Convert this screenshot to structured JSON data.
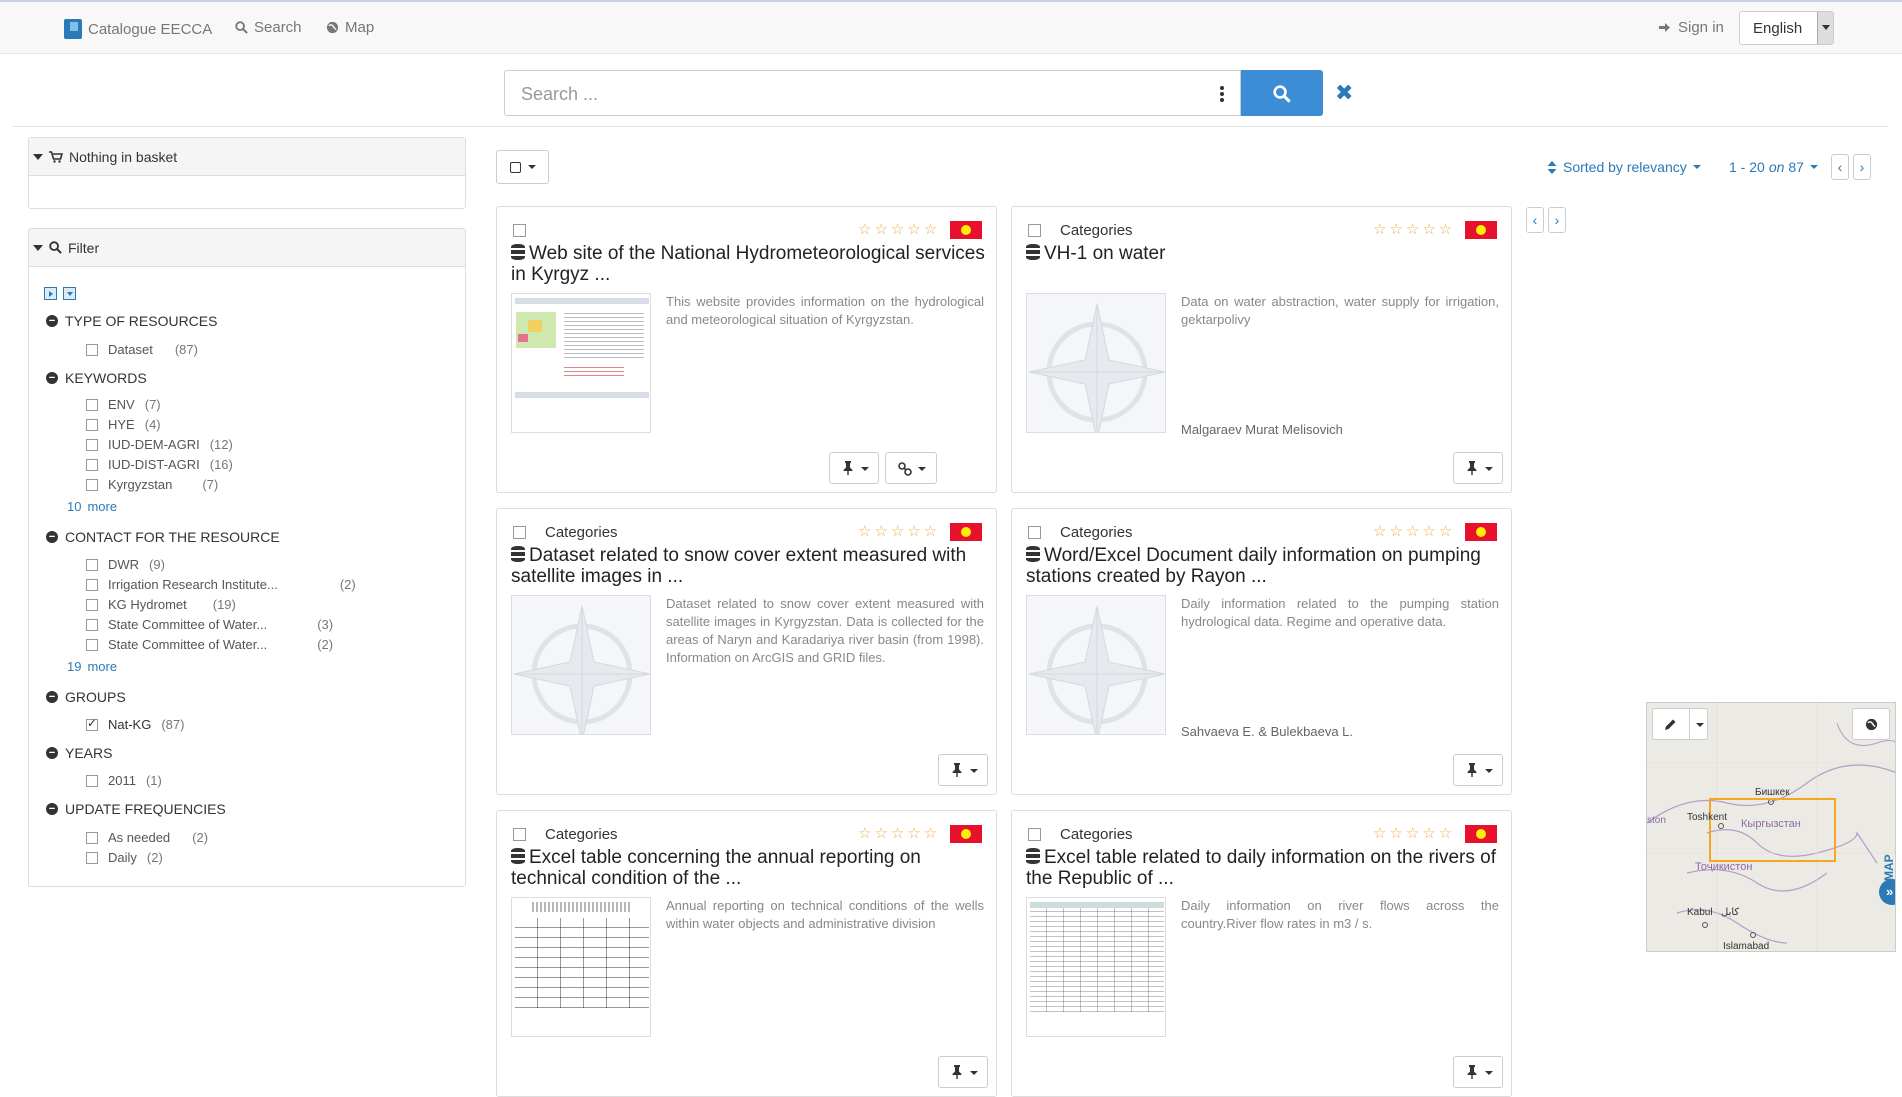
{
  "navbar": {
    "brand": "Catalogue EECCA",
    "search": "Search",
    "map": "Map",
    "signin": "Sign in",
    "language": "English"
  },
  "search": {
    "placeholder": "Search ..."
  },
  "basket": {
    "title": "Nothing in basket"
  },
  "filter": {
    "title": "Filter",
    "facets": [
      {
        "title": "TYPE OF RESOURCES",
        "items": [
          {
            "label": "Dataset",
            "count": "(87)"
          }
        ]
      },
      {
        "title": "KEYWORDS",
        "items": [
          {
            "label": "ENV",
            "count": "(7)"
          },
          {
            "label": "HYE",
            "count": "(4)"
          },
          {
            "label": "IUD-DEM-AGRI",
            "count": "(12)"
          },
          {
            "label": "IUD-DIST-AGRI",
            "count": "(16)"
          },
          {
            "label": "Kyrgyzstan",
            "count": "(7)"
          }
        ],
        "more_count": "10",
        "more_label": "more"
      },
      {
        "title": "CONTACT FOR THE RESOURCE",
        "items": [
          {
            "label": "DWR",
            "count": "(9)"
          },
          {
            "label": "Irrigation Research Institute...",
            "count": "(2)"
          },
          {
            "label": "KG Hydromet",
            "count": "(19)"
          },
          {
            "label": "State Committee of Water...",
            "count": "(3)"
          },
          {
            "label": "State Committee of Water...",
            "count": "(2)"
          }
        ],
        "more_count": "19",
        "more_label": "more"
      },
      {
        "title": "GROUPS",
        "items": [
          {
            "label": "Nat-KG",
            "count": "(87)",
            "checked": true
          }
        ]
      },
      {
        "title": "YEARS",
        "items": [
          {
            "label": "2011",
            "count": "(1)"
          }
        ]
      },
      {
        "title": "UPDATE FREQUENCIES",
        "items": [
          {
            "label": "As needed",
            "count": "(2)"
          },
          {
            "label": "Daily",
            "count": "(2)"
          }
        ]
      }
    ]
  },
  "results": {
    "sort_label": "Sorted by relevancy",
    "range_start": "1 - 20",
    "range_on": "on",
    "range_total": "87",
    "cards": [
      {
        "category": "",
        "title": "Web site of the National Hydrometeorological services in Kyrgyz ...",
        "description": "This website provides information on the hydrological and meteorological situation of Kyrgyzstan.",
        "author": "",
        "thumb": "website",
        "has_link_button": true
      },
      {
        "category": "Categories",
        "title": "VH-1 on water",
        "description": "Data on water abstraction, water supply for irrigation, gektarpolivy",
        "author": "Malgaraev Murat Melisovich",
        "thumb": "compass",
        "has_link_button": false
      },
      {
        "category": "Categories",
        "title": "Dataset related to snow cover extent measured with satellite images in ...",
        "description": "Dataset related to snow cover extent measured with satellite images in Kyrgyzstan. Data is collected for the areas of Naryn and Karadariya river basin (from 1998). Information on ArcGIS and GRID files.",
        "author": "",
        "thumb": "compass",
        "has_link_button": false
      },
      {
        "category": "Categories",
        "title": "Word/Excel Document daily information on pumping stations created by Rayon ...",
        "description": "Daily information related to the pumping station hydrological data. Regime and operative data.",
        "author": "Sahvaeva E. & Bulekbaeva L.",
        "thumb": "compass",
        "has_link_button": false
      },
      {
        "category": "Categories",
        "title": "Excel table concerning the annual reporting on technical condition of the ...",
        "description": "Annual reporting on technical conditions of the wells within water objects and administrative division",
        "author": "",
        "thumb": "table",
        "has_link_button": false
      },
      {
        "category": "Categories",
        "title": "Excel table related to daily information on the rivers of the Republic of ...",
        "description": "Daily information on river flows across the country.River flow rates in m3 / s.",
        "author": "",
        "thumb": "spreadsheet",
        "has_link_button": false
      }
    ]
  },
  "map": {
    "label": "MAP",
    "places": [
      "Бишкек",
      "Toshkent",
      "Кыргызстан",
      "Тоҷикистон",
      "Kabul",
      "کابل",
      "Islamabad",
      "ston"
    ]
  },
  "colors": {
    "accent": "#3c8dd5",
    "link": "#2a7ab8",
    "star": "#f0ad4e",
    "flag": "#e8112d",
    "bbox": "#f5a623"
  }
}
